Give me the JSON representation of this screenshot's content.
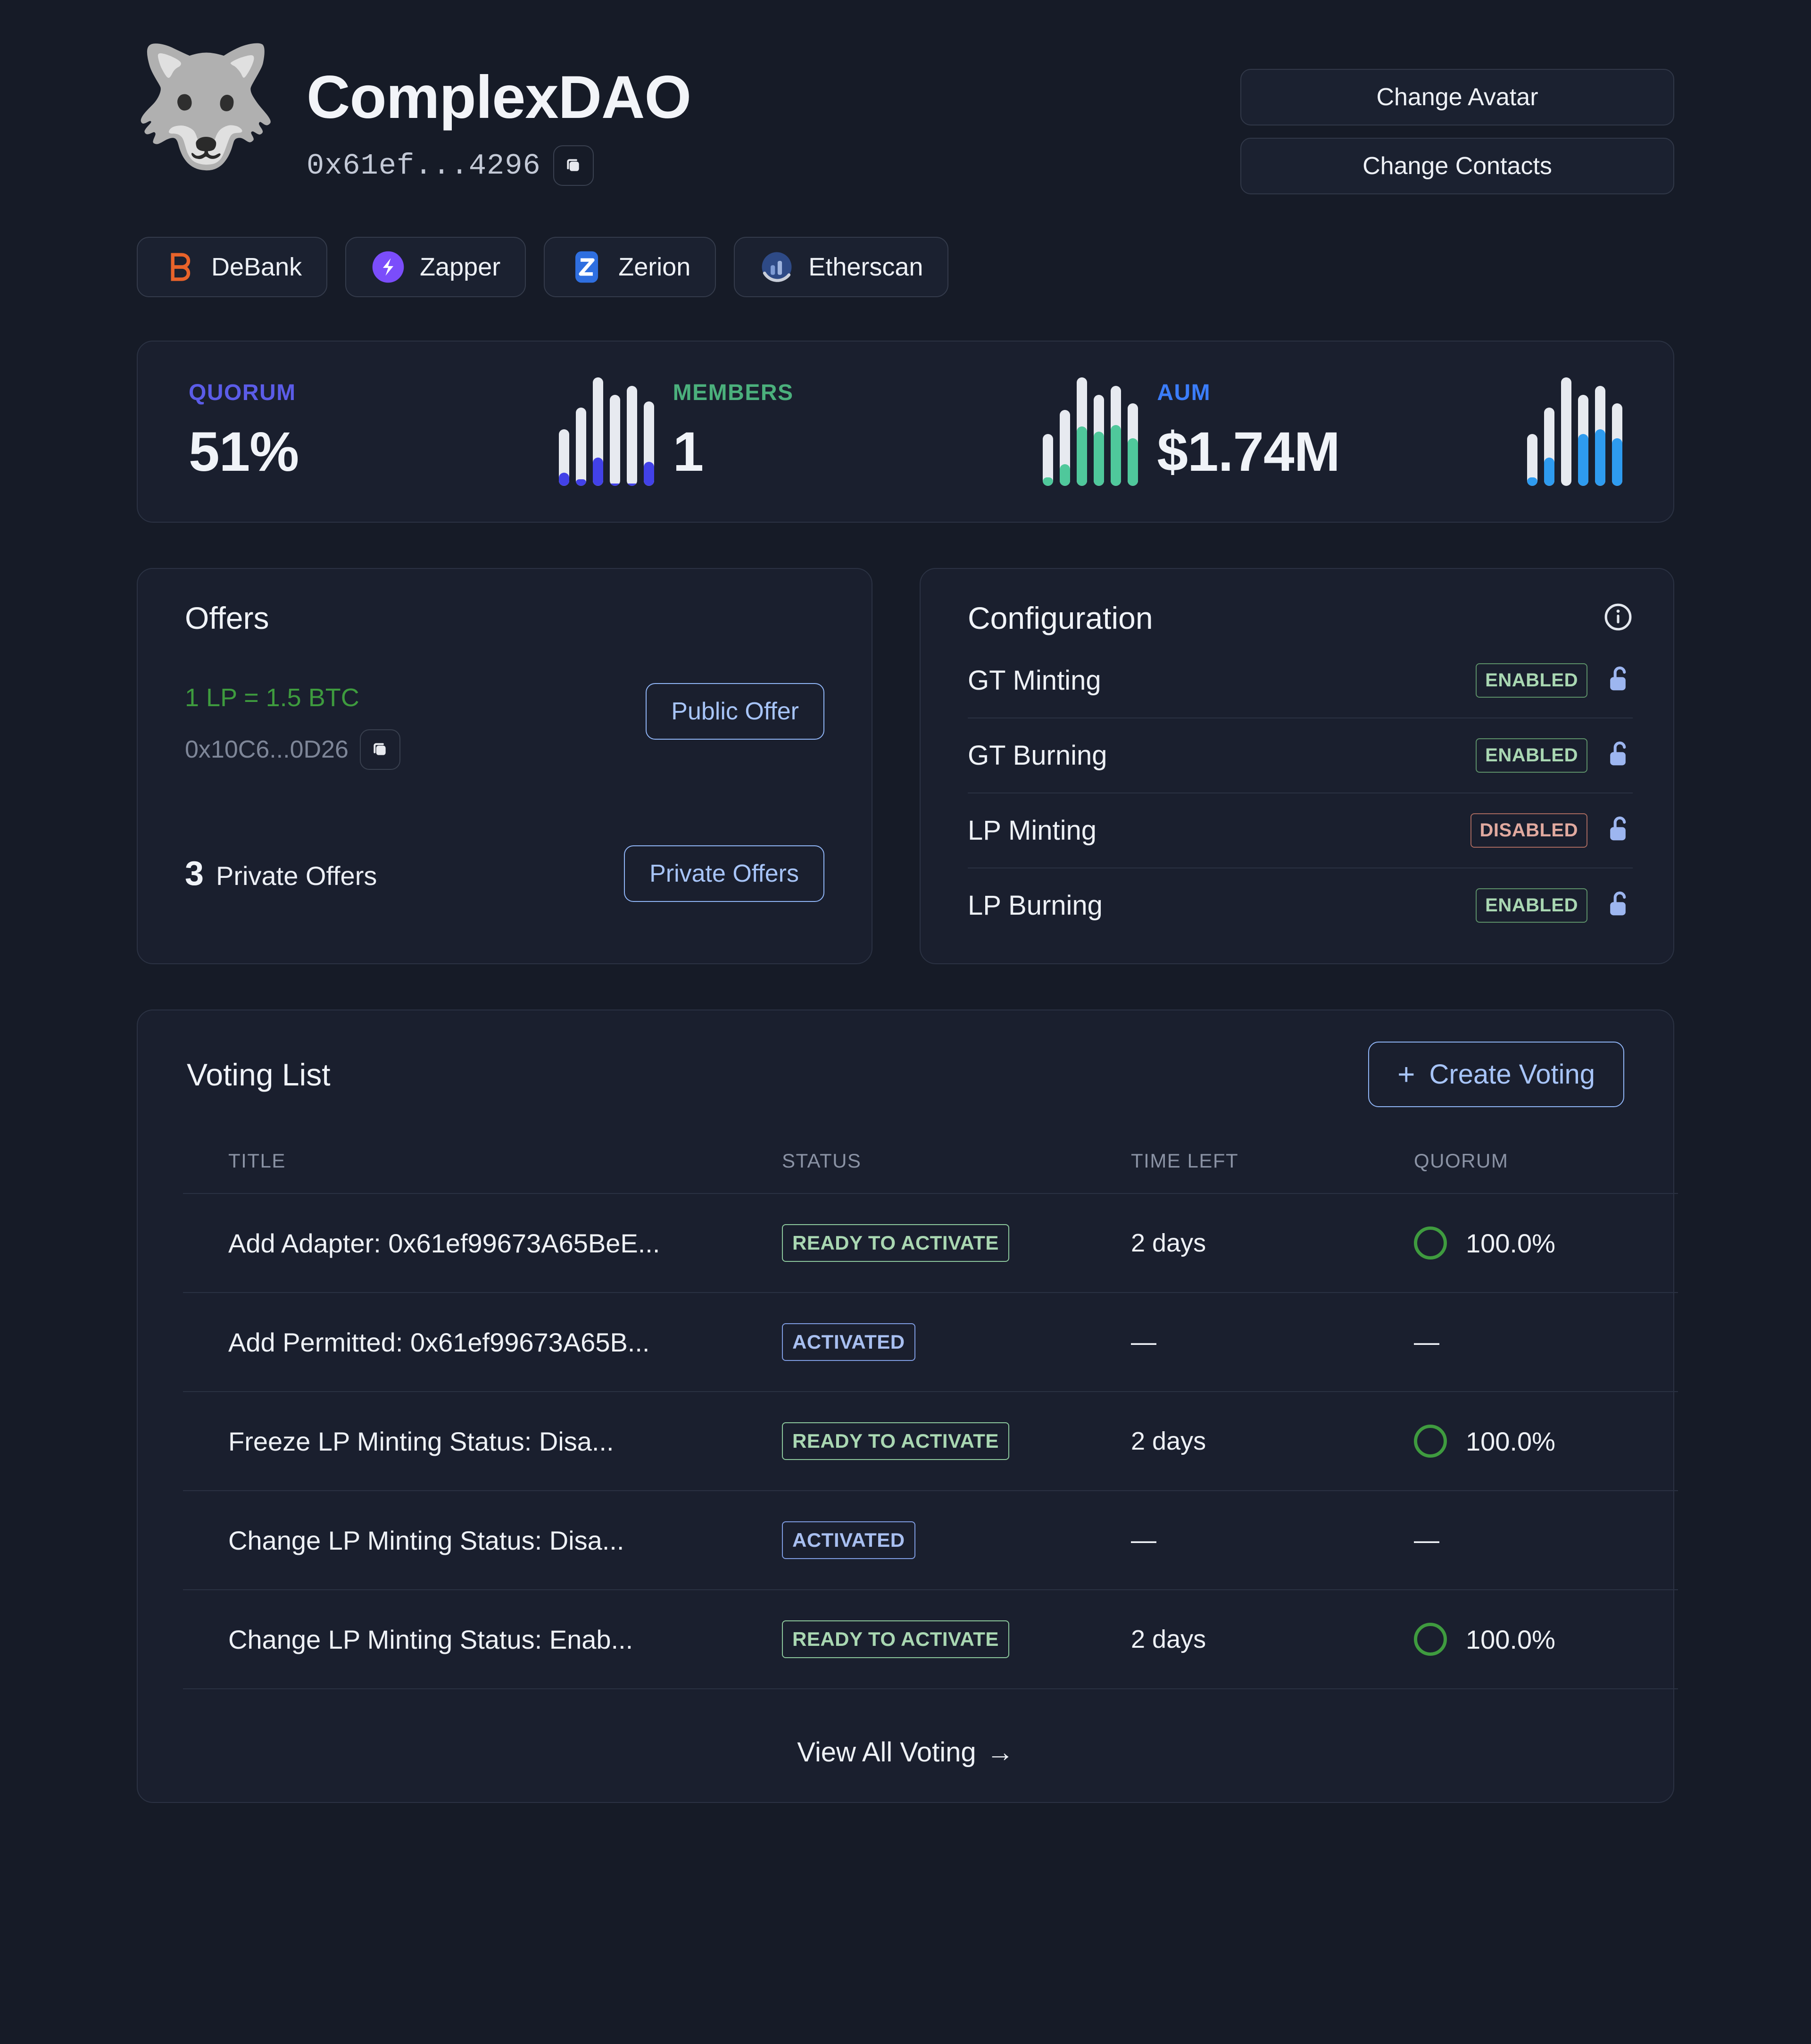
{
  "header": {
    "avatar_icon": "wolf-face-emoji",
    "dao_name": "ComplexDAO",
    "address": "0x61ef...4296",
    "copy_icon": "copy-icon",
    "change_avatar_label": "Change Avatar",
    "change_contacts_label": "Change Contacts"
  },
  "links": [
    {
      "label": "DeBank",
      "icon": "debank-icon",
      "color": "#e8632a"
    },
    {
      "label": "Zapper",
      "icon": "zapper-icon",
      "color": "#7b4dfb"
    },
    {
      "label": "Zerion",
      "icon": "zerion-icon",
      "color": "#2f6fe0"
    },
    {
      "label": "Etherscan",
      "icon": "etherscan-icon",
      "color": "#3a5fa8"
    }
  ],
  "stats": [
    {
      "label": "QUORUM",
      "value": "51%",
      "label_color": "#5b5ce8",
      "bar_color": "#4241e8"
    },
    {
      "label": "MEMBERS",
      "value": "1",
      "label_color": "#4bb07c",
      "bar_color": "#4fc89b"
    },
    {
      "label": "AUM",
      "value": "$1.74M",
      "label_color": "#3b7dfb",
      "bar_color": "#2e9bf0"
    }
  ],
  "chart_data": [
    {
      "type": "bar",
      "title": "QUORUM",
      "categories": [
        "1",
        "2",
        "3",
        "4",
        "5",
        "6"
      ],
      "series": [
        {
          "name": "track",
          "values": [
            52,
            72,
            100,
            84,
            92,
            78
          ]
        },
        {
          "name": "filled",
          "values": [
            12,
            6,
            26,
            2,
            2,
            22
          ]
        }
      ],
      "ylim": [
        0,
        100
      ],
      "grid": false,
      "legend": "none",
      "xlabel": "",
      "ylabel": ""
    },
    {
      "type": "bar",
      "title": "MEMBERS",
      "categories": [
        "1",
        "2",
        "3",
        "4",
        "5",
        "6"
      ],
      "series": [
        {
          "name": "track",
          "values": [
            48,
            70,
            100,
            84,
            92,
            76
          ]
        },
        {
          "name": "filled",
          "values": [
            8,
            20,
            55,
            50,
            56,
            44
          ]
        }
      ],
      "ylim": [
        0,
        100
      ],
      "grid": false,
      "legend": "none",
      "xlabel": "",
      "ylabel": ""
    },
    {
      "type": "bar",
      "title": "AUM",
      "categories": [
        "1",
        "2",
        "3",
        "4",
        "5",
        "6"
      ],
      "series": [
        {
          "name": "track",
          "values": [
            48,
            72,
            100,
            84,
            92,
            76
          ]
        },
        {
          "name": "filled",
          "values": [
            8,
            26,
            0,
            48,
            52,
            44
          ]
        }
      ],
      "ylim": [
        0,
        100
      ],
      "grid": false,
      "legend": "none",
      "xlabel": "",
      "ylabel": ""
    }
  ],
  "offers": {
    "title": "Offers",
    "rate": "1 LP = 1.5 BTC",
    "address": "0x10C6...0D26",
    "copy_icon": "copy-icon",
    "public_offer_label": "Public Offer",
    "private_count": "3",
    "private_label": "Private Offers",
    "private_button_label": "Private Offers"
  },
  "configuration": {
    "title": "Configuration",
    "info_icon": "info-circle-icon",
    "rows": [
      {
        "name": "GT Minting",
        "status": "ENABLED",
        "lock_icon": "unlock-icon"
      },
      {
        "name": "GT Burning",
        "status": "ENABLED",
        "lock_icon": "unlock-icon"
      },
      {
        "name": "LP Minting",
        "status": "DISABLED",
        "lock_icon": "unlock-icon"
      },
      {
        "name": "LP Burning",
        "status": "ENABLED",
        "lock_icon": "unlock-icon"
      }
    ]
  },
  "voting": {
    "title": "Voting List",
    "create_label": "Create Voting",
    "plus_icon": "plus-icon",
    "columns": [
      "TITLE",
      "STATUS",
      "TIME LEFT",
      "QUORUM"
    ],
    "rows": [
      {
        "title": "Add Adapter: 0x61ef99673A65BeE...",
        "status": "READY TO ACTIVATE",
        "time": "2 days",
        "quorum": "100.0%",
        "has_ring": true
      },
      {
        "title": "Add Permitted: 0x61ef99673A65B...",
        "status": "ACTIVATED",
        "time": "—",
        "quorum": "—",
        "has_ring": false
      },
      {
        "title": "Freeze LP Minting Status: Disa...",
        "status": "READY TO ACTIVATE",
        "time": "2 days",
        "quorum": "100.0%",
        "has_ring": true
      },
      {
        "title": "Change LP Minting Status: Disa...",
        "status": "ACTIVATED",
        "time": "—",
        "quorum": "—",
        "has_ring": false
      },
      {
        "title": "Change LP Minting Status: Enab...",
        "status": "READY TO ACTIVATE",
        "time": "2 days",
        "quorum": "100.0%",
        "has_ring": true
      }
    ],
    "view_all_label": "View All Voting",
    "arrow_icon": "arrow-right-icon"
  },
  "colors": {
    "page_bg": "#161b27",
    "card_bg": "#1a1f2e",
    "card_border": "#2b3243",
    "accent_blue": "#a7c4f8",
    "green": "#3e9b3e",
    "enabled": "#a9d7b2",
    "disabled": "#e0a99f"
  }
}
